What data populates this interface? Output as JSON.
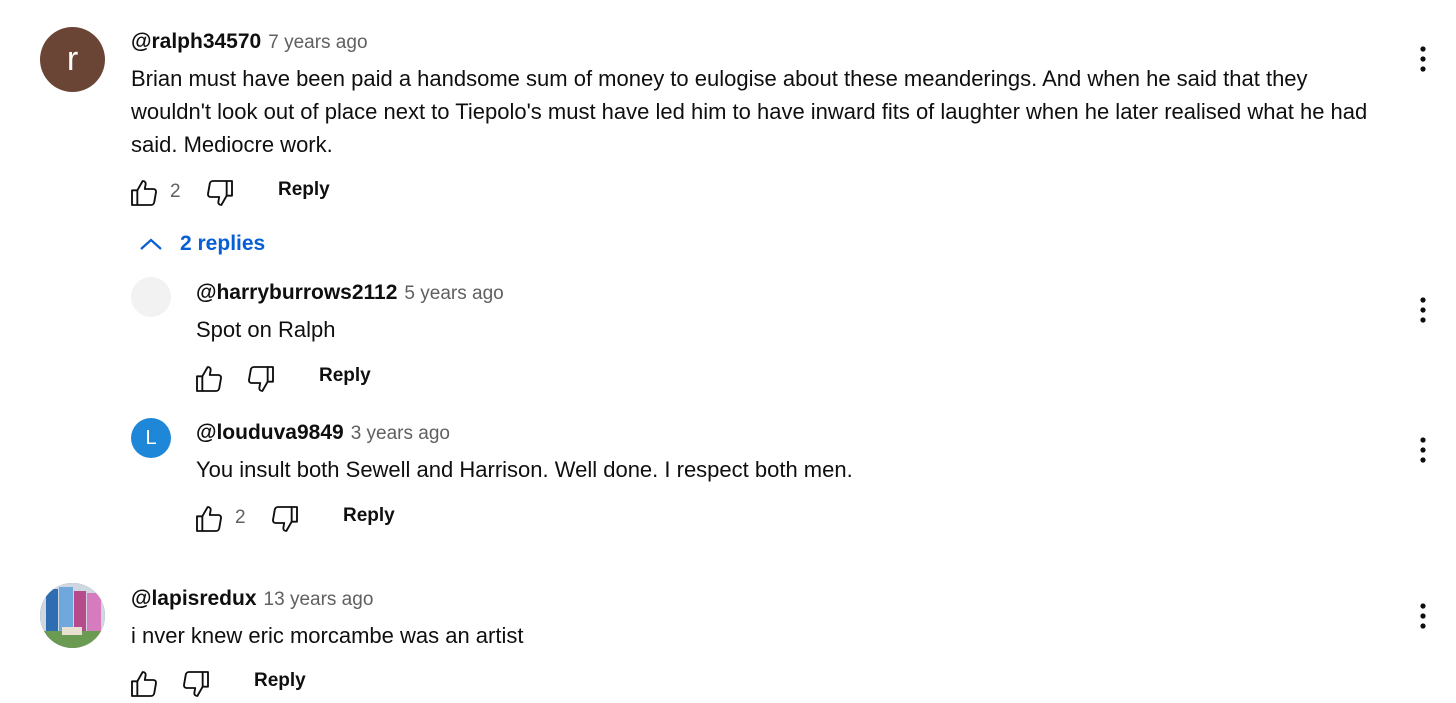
{
  "colors": {
    "avatar_ralph": "#6a4536",
    "avatar_harry": "#f2f2f2",
    "avatar_louduva": "#1e87d8",
    "link_blue": "#065fd4",
    "text_secondary": "#606060"
  },
  "comments": [
    {
      "avatar_letter": "r",
      "author": "@ralph34570",
      "time": "7 years ago",
      "text": "Brian must have been paid a handsome sum of money to eulogise about these meanderings. And when he said that they wouldn't look out of place next to Tiepolo's must have led him to have inward fits of laughter when he later realised what he had said. Mediocre work.",
      "likes": "2",
      "reply_label": "Reply",
      "replies_toggle": "2 replies",
      "replies": [
        {
          "avatar_letter": "",
          "author": "@harryburrows2112",
          "time": "5 years ago",
          "text": "Spot on Ralph",
          "likes": "",
          "reply_label": "Reply"
        },
        {
          "avatar_letter": "L",
          "author": "@louduva9849",
          "time": "3 years ago",
          "text": "You insult both Sewell and Harrison. Well done. I respect both men.",
          "likes": "2",
          "reply_label": "Reply"
        }
      ]
    },
    {
      "avatar_letter": "",
      "author": "@lapisredux",
      "time": "13 years ago",
      "text": "i nver knew eric morcambe was an artist",
      "likes": "",
      "reply_label": "Reply"
    }
  ],
  "icons": {
    "like": "thumbs-up-icon",
    "dislike": "thumbs-down-icon",
    "menu": "more-vert-icon",
    "collapse": "chevron-up-icon"
  }
}
